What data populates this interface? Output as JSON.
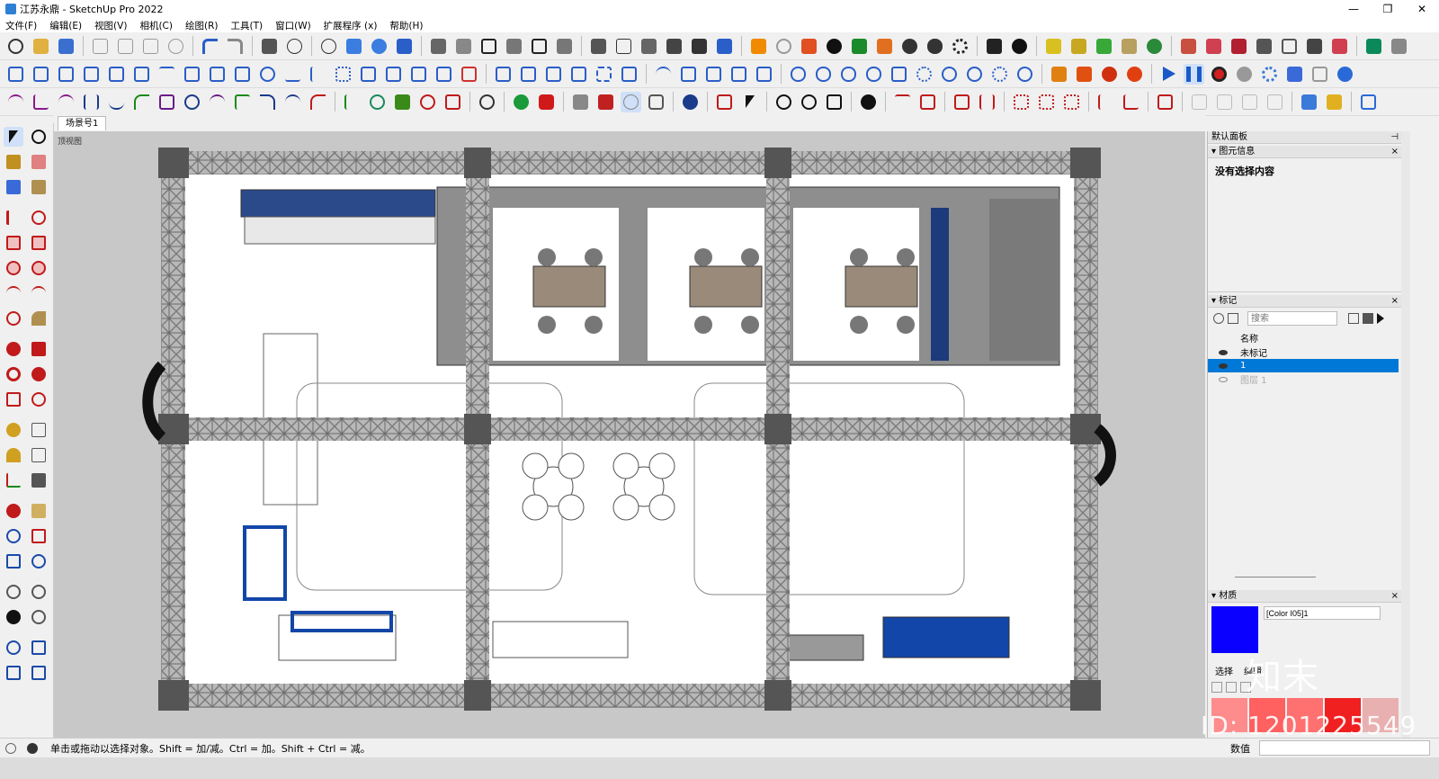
{
  "window": {
    "title": "江苏永鼎 - SketchUp Pro 2022",
    "minimize": "—",
    "maximize": "❐",
    "close": "✕"
  },
  "menu": [
    "文件(F)",
    "编辑(E)",
    "视图(V)",
    "相机(C)",
    "绘图(R)",
    "工具(T)",
    "窗口(W)",
    "扩展程序 (x)",
    "帮助(H)"
  ],
  "scene": {
    "tab": "场景号1",
    "view_label": "顶视图"
  },
  "panel": {
    "title": "默认面板",
    "entity_info": {
      "header": "图元信息",
      "text": "没有选择内容"
    },
    "tags": {
      "header": "标记",
      "search_placeholder": "搜索",
      "col_name": "名称",
      "rows": [
        {
          "name": "未标记",
          "visible": true,
          "selected": false
        },
        {
          "name": "1",
          "visible": true,
          "selected": false
        },
        {
          "name": "图层 1",
          "visible": false,
          "selected": false
        }
      ]
    },
    "materials": {
      "header": "材质",
      "name": "[Color I05]1",
      "swatch": "#0a00ff",
      "select_tab": "选择",
      "edit_tab": "编辑"
    }
  },
  "status": {
    "text": "单击或拖动以选择对象。Shift = 加/减。Ctrl = 加。Shift + Ctrl = 减。",
    "value_label": "数值"
  },
  "watermark": {
    "brand": "知末",
    "id": "ID: 1201225549"
  },
  "colors": {
    "accent_blue": "#0078d7",
    "truss": "#8a8a8a",
    "booth_blue": "#1246a8"
  }
}
